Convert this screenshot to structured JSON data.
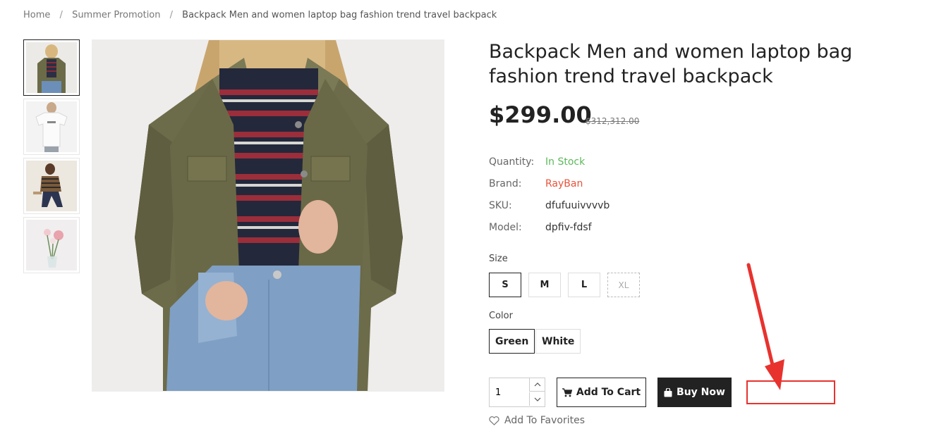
{
  "breadcrumb": {
    "home": "Home",
    "category": "Summer Promotion",
    "current": "Backpack Men and women laptop bag fashion trend travel backpack",
    "separator": "/"
  },
  "thumbnails": [
    {
      "name": "thumb-olive-jacket"
    },
    {
      "name": "thumb-white-tshirt"
    },
    {
      "name": "thumb-plaid-seated"
    },
    {
      "name": "thumb-flowers-vase"
    }
  ],
  "product": {
    "title": "Backpack Men and women laptop bag fashion trend travel backpack",
    "price": "$299.00",
    "old_price": "$312,312.00"
  },
  "specs": {
    "quantity_label": "Quantity:",
    "quantity_value": "In Stock",
    "brand_label": "Brand:",
    "brand_value": "RayBan",
    "sku_label": "SKU:",
    "sku_value": "dfufuuivvvvb",
    "model_label": "Model:",
    "model_value": "dpfiv-fdsf"
  },
  "size": {
    "label": "Size",
    "options": [
      "S",
      "M",
      "L",
      "XL"
    ],
    "selected": "S",
    "disabled": "XL"
  },
  "color": {
    "label": "Color",
    "options": [
      "Green",
      "White"
    ],
    "selected": "Green"
  },
  "purchase": {
    "qty_value": "1",
    "add_to_cart": "Add To Cart",
    "buy_now": "Buy Now",
    "add_to_favorites": "Add To Favorites"
  },
  "colors": {
    "in_stock": "#5cb85c",
    "brand": "#e8533a",
    "annotation": "#e8322e",
    "buy_bg": "#222222"
  }
}
